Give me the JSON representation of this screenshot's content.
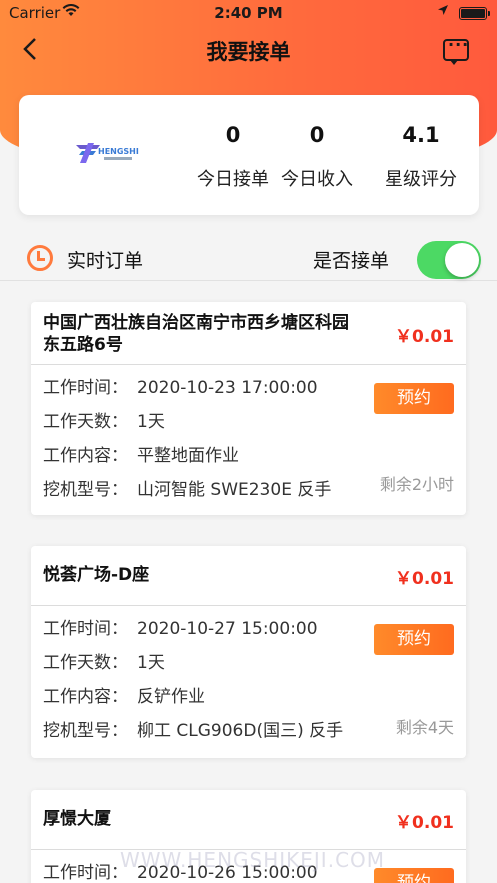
{
  "status_bar": {
    "carrier": "Carrier",
    "time": "2:40 PM"
  },
  "nav": {
    "title": "我要接单",
    "back_icon": "chevron-left-icon",
    "message_icon": "message-icon"
  },
  "stats": {
    "logo_text": "HENGSHI",
    "items": [
      {
        "value": "0",
        "label": "今日接单"
      },
      {
        "value": "0",
        "label": "今日收入"
      },
      {
        "value": "4.1",
        "label": "星级评分"
      }
    ]
  },
  "section": {
    "title": "实时订单",
    "toggle_label": "是否接单",
    "toggle_on": true,
    "accent": "#ff7a3d",
    "toggle_color": "#4cd964"
  },
  "field_labels": {
    "time": "工作时间：",
    "days": "工作天数：",
    "content": "工作内容：",
    "model": "挖机型号："
  },
  "orders": [
    {
      "address": "中国广西壮族自治区南宁市西乡塘区科园东五路6号",
      "price": "￥0.01",
      "time": "2020-10-23 17:00:00",
      "days": "1天",
      "content": "平整地面作业",
      "model": "山河智能 SWE230E 反手",
      "button": "预约",
      "remaining": "剩余2小时"
    },
    {
      "address": "悦荟广场-D座",
      "price": "￥0.01",
      "time": "2020-10-27 15:00:00",
      "days": "1天",
      "content": "反铲作业",
      "model": "柳工 CLG906D(国三) 反手",
      "button": "预约",
      "remaining": "剩余4天"
    },
    {
      "address": "厚憬大厦",
      "price": "￥0.01",
      "time": "2020-10-26 15:00:00",
      "button": "预约"
    }
  ],
  "watermark": "WWW.HENGSHIKEJI.COM"
}
